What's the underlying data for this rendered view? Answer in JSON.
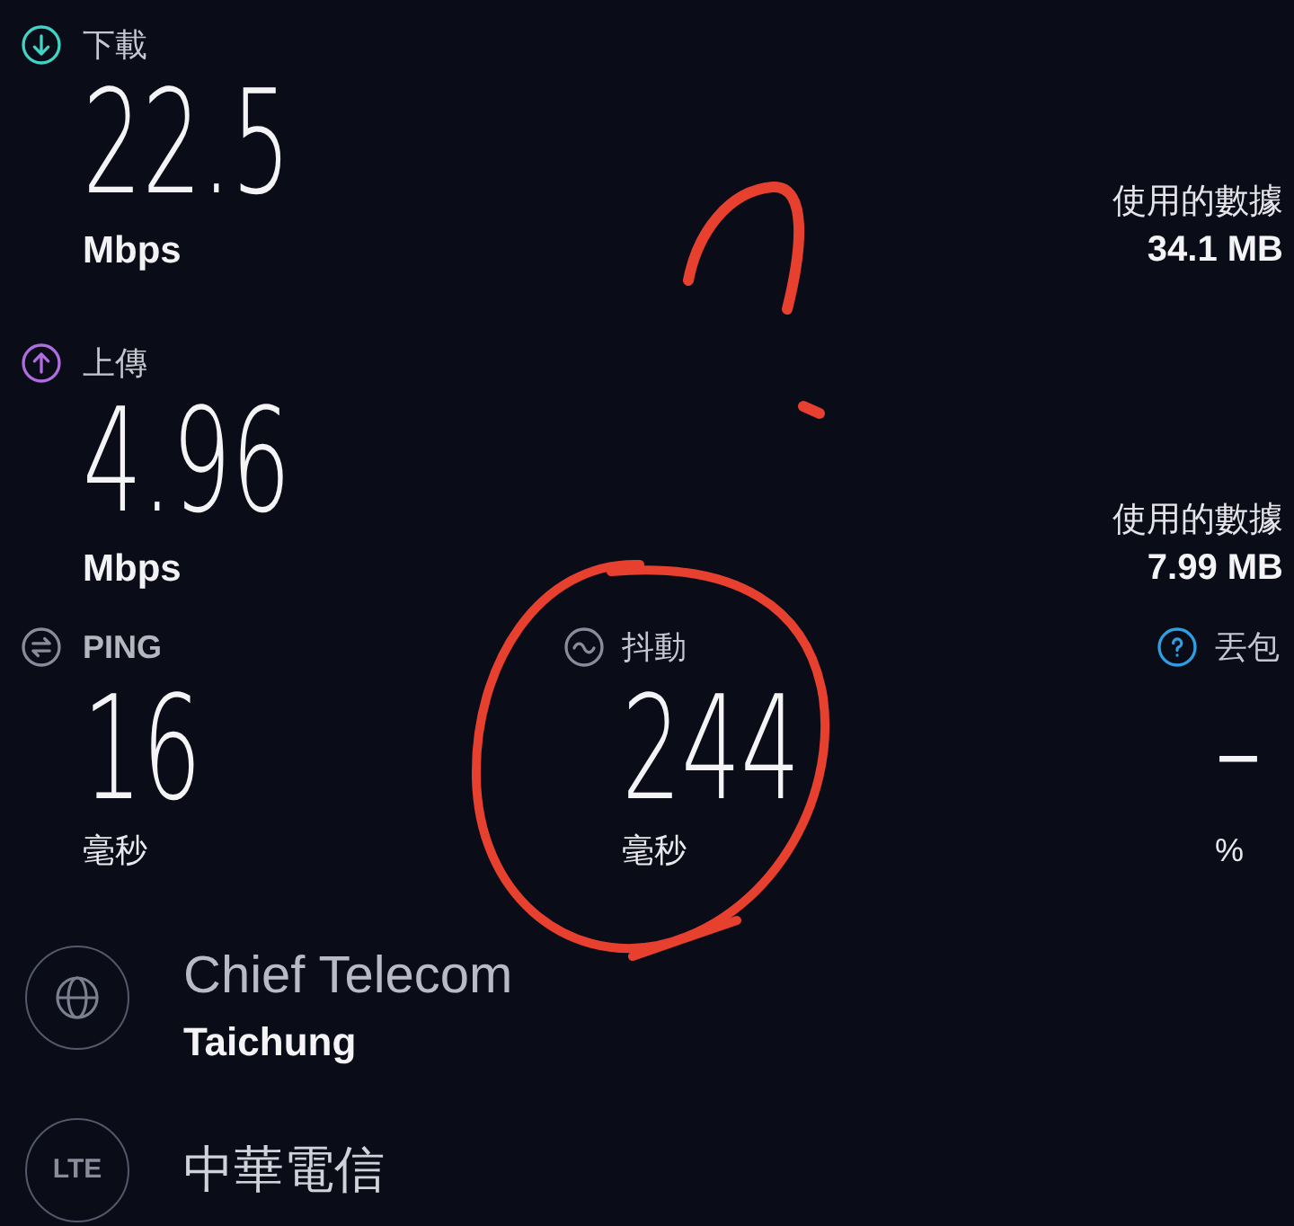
{
  "speed_results": [
    {
      "kind": "download",
      "label": "下載",
      "value": "22.5",
      "unit": "Mbps",
      "data_used_label": "使用的數據",
      "data_used": "34.1 MB"
    },
    {
      "kind": "upload",
      "label": "上傳",
      "value": "4.96",
      "unit": "Mbps",
      "data_used_label": "使用的數據",
      "data_used": "7.99 MB"
    }
  ],
  "latency_metrics": [
    {
      "kind": "ping",
      "label": "PING",
      "value": "16",
      "unit": "毫秒"
    },
    {
      "kind": "jitter",
      "label": "抖動",
      "value": "244",
      "unit": "毫秒"
    },
    {
      "kind": "packet_loss",
      "label": "丟包",
      "value": "–",
      "unit": "%"
    }
  ],
  "server": {
    "provider": "Chief Telecom",
    "location": "Taichung"
  },
  "connection": {
    "network_type": "LTE",
    "carrier": "中華電信"
  }
}
